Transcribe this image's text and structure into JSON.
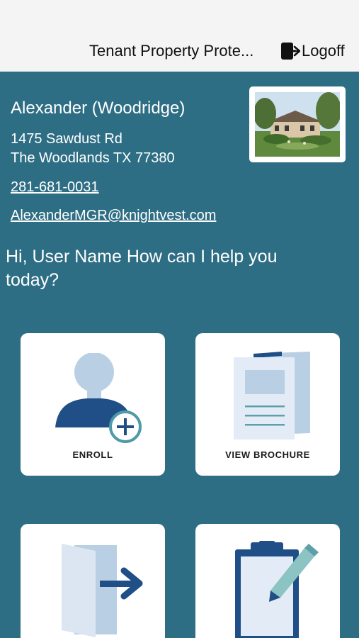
{
  "header": {
    "title": "Tenant Property Prote...",
    "logoff_label": "Logoff"
  },
  "property": {
    "name": "Alexander (Woodridge)",
    "address_line1": "1475 Sawdust Rd",
    "address_line2": "The Woodlands TX 77380",
    "phone": "281-681-0031",
    "email": "AlexanderMGR@knightvest.com"
  },
  "greeting": "Hi, User Name How can I help you today?",
  "tiles": [
    {
      "label": "ENROLL",
      "icon": "enroll-person-plus-icon"
    },
    {
      "label": "VIEW BROCHURE",
      "icon": "brochure-icon"
    },
    {
      "label": "",
      "icon": "exit-door-arrow-icon"
    },
    {
      "label": "",
      "icon": "clipboard-pen-icon"
    }
  ],
  "colors": {
    "background": "#2e6e84",
    "topbar": "#f4f4f4",
    "icon_dark": "#1f4f86",
    "icon_light": "#b9cfe4",
    "plus_ring": "#4f9aa8"
  }
}
